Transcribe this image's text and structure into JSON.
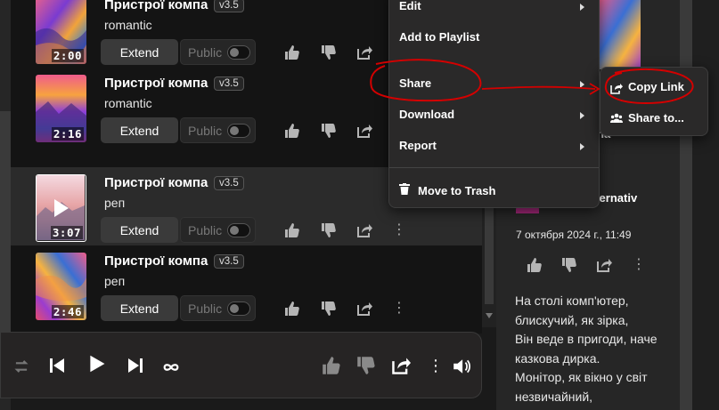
{
  "songs": [
    {
      "title": "Пристрої компа",
      "version": "v3.5",
      "genre": "romantic",
      "duration": "2:00",
      "extend_label": "Extend",
      "public_label": "Public"
    },
    {
      "title": "Пристрої компа",
      "version": "v3.5",
      "genre": "romantic",
      "duration": "2:16",
      "extend_label": "Extend",
      "public_label": "Public"
    },
    {
      "title": "Пристрої компа",
      "version": "v3.5",
      "genre": "реп",
      "duration": "3:07",
      "extend_label": "Extend",
      "public_label": "Public"
    },
    {
      "title": "Пристрої компа",
      "version": "v3.5",
      "genre": "реп",
      "duration": "2:46",
      "extend_label": "Extend",
      "public_label": "Public"
    }
  ],
  "menu": {
    "items": [
      "Edit",
      "Add to Playlist",
      "Share",
      "Download",
      "Report",
      "Move to Trash"
    ]
  },
  "submenu": {
    "items": [
      "Copy Link",
      "Share to..."
    ]
  },
  "right_panel": {
    "title_partial": "na",
    "author_partial": "sAlternativ",
    "date": "7 октября 2024 г., 11:49",
    "lyrics": [
      "На столі комп'ютер,",
      "блискучий, як зірка,",
      "Він веде в пригоди, наче",
      "казкова дирка.",
      "Монітор, як вікно у світ",
      "незвичайний,"
    ]
  },
  "colors": {
    "annotation": "#d40000",
    "background": "#141414",
    "menu_bg": "#2a2929"
  }
}
